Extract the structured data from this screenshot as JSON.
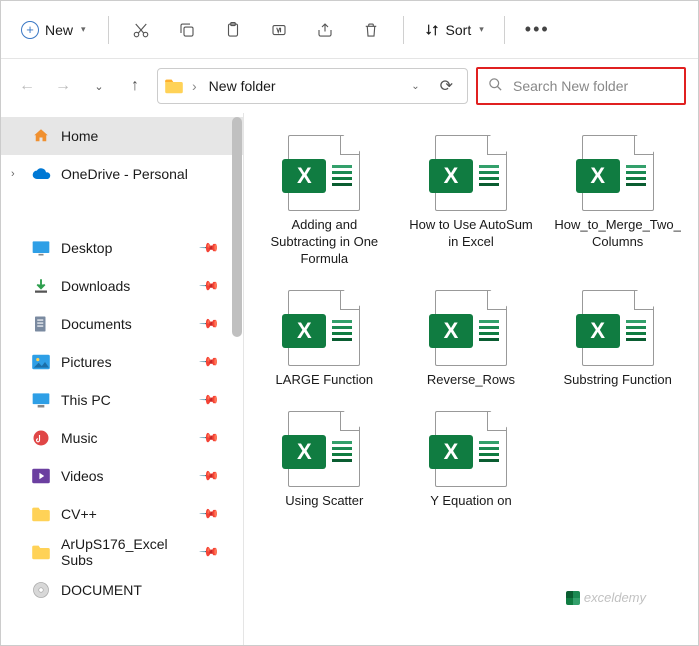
{
  "toolbar": {
    "new_label": "New",
    "sort_label": "Sort"
  },
  "navigation": {
    "current_folder": "New folder",
    "search_placeholder": "Search New folder"
  },
  "sidebar": {
    "items": [
      {
        "label": "Home",
        "icon": "home",
        "selected": true
      },
      {
        "label": "OneDrive - Personal",
        "icon": "onedrive",
        "expandable": true
      }
    ],
    "quick": [
      {
        "label": "Desktop",
        "icon": "desktop",
        "pinned": true
      },
      {
        "label": "Downloads",
        "icon": "downloads",
        "pinned": true
      },
      {
        "label": "Documents",
        "icon": "documents",
        "pinned": true
      },
      {
        "label": "Pictures",
        "icon": "pictures",
        "pinned": true
      },
      {
        "label": "This PC",
        "icon": "thispc",
        "pinned": true
      },
      {
        "label": "Music",
        "icon": "music",
        "pinned": true
      },
      {
        "label": "Videos",
        "icon": "videos",
        "pinned": true
      },
      {
        "label": "CV++",
        "icon": "folder",
        "pinned": true
      },
      {
        "label": "ArUpS176_Excel Subs",
        "icon": "folder",
        "pinned": true
      },
      {
        "label": "DOCUMENT",
        "icon": "cd",
        "pinned": false
      }
    ]
  },
  "files": [
    {
      "name": "Adding and Subtracting in One Formula"
    },
    {
      "name": "How to Use AutoSum in Excel"
    },
    {
      "name": "How_to_Merge_Two_Columns"
    },
    {
      "name": "LARGE Function"
    },
    {
      "name": "Reverse_Rows"
    },
    {
      "name": "Substring Function"
    },
    {
      "name": "Using Scatter"
    },
    {
      "name": "Y Equation on"
    }
  ],
  "watermark": "exceldemy"
}
